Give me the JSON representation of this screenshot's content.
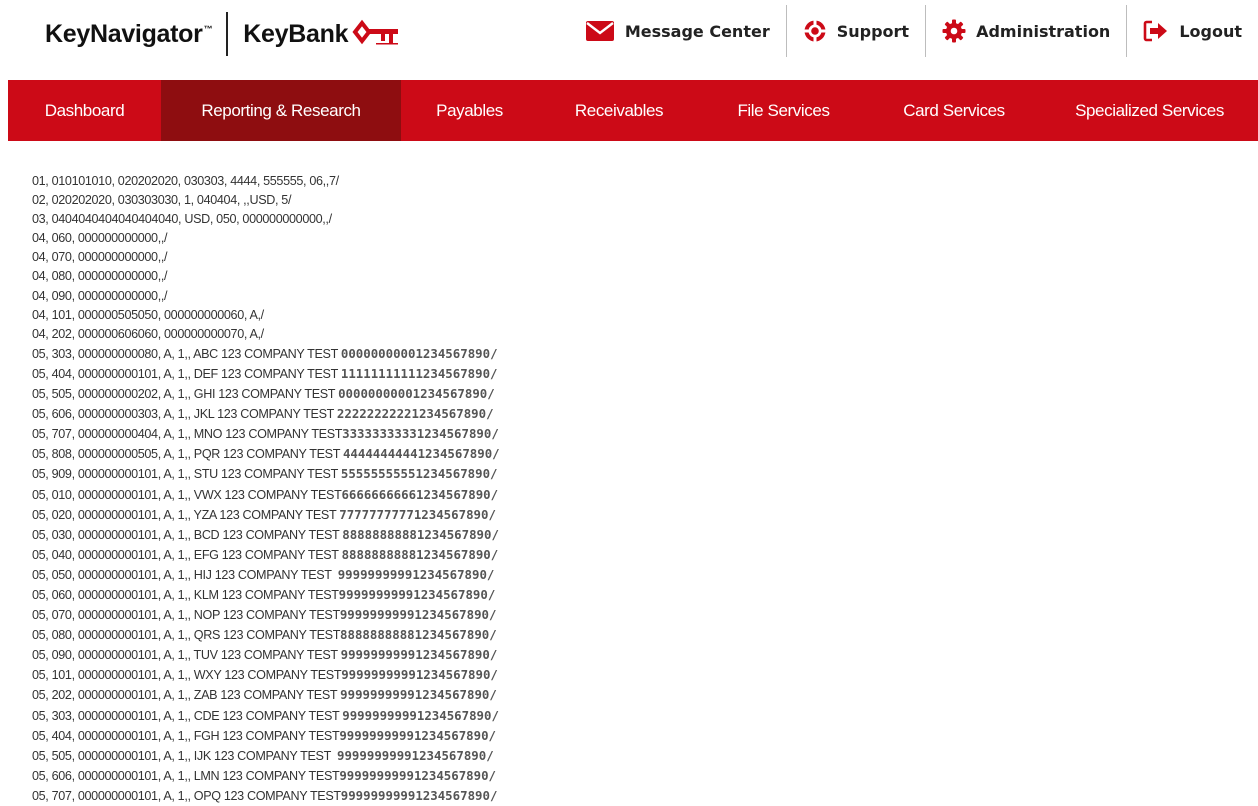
{
  "header": {
    "brand_primary": "KeyNavigator",
    "brand_mark": "™",
    "brand_secondary": "KeyBank",
    "utility_links": [
      {
        "label": "Message Center",
        "icon": "envelope-icon"
      },
      {
        "label": "Support",
        "icon": "lifebuoy-icon"
      },
      {
        "label": "Administration",
        "icon": "gear-icon"
      },
      {
        "label": "Logout",
        "icon": "logout-icon"
      }
    ]
  },
  "colors": {
    "brand_red": "#cc0a17",
    "active_tab_red": "#8e0d10",
    "text_gray": "#333333"
  },
  "nav": {
    "active": "Reporting & Research",
    "tabs": [
      {
        "label": "Dashboard"
      },
      {
        "label": "Reporting & Research"
      },
      {
        "label": "Payables"
      },
      {
        "label": "Receivables"
      },
      {
        "label": "File Services"
      },
      {
        "label": "Card Services"
      },
      {
        "label": "Specialized Services"
      }
    ]
  },
  "bai_file": {
    "header_lines": [
      "01, 010101010, 020202020, 030303, 4444, 555555, 06,,7/",
      "02, 020202020, 030303030, 1, 040404, ,,USD, 5/",
      "03, 0404040404040404040, USD, 050, 000000000000,,/",
      "04, 060, 000000000000,,/",
      "04, 070, 000000000000,,/",
      "04, 080, 000000000000,,/",
      "04, 090, 000000000000,,/",
      "04, 101, 000000505050, 000000000060, A,/",
      "04, 202, 000000606060, 000000000070, A,/"
    ],
    "detail_lines": [
      {
        "text": "05, 303, 000000000080, A, 1,, ABC 123 COMPANY TEST ",
        "ref": "00000000001234567890/"
      },
      {
        "text": "05, 404, 000000000101, A, 1,, DEF 123 COMPANY TEST ",
        "ref": "11111111111234567890/"
      },
      {
        "text": "05, 505, 000000000202, A, 1,, GHI 123 COMPANY TEST ",
        "ref": "00000000001234567890/"
      },
      {
        "text": "05, 606, 000000000303, A, 1,, JKL 123 COMPANY TEST ",
        "ref": "22222222221234567890/"
      },
      {
        "text": "05, 707, 000000000404, A, 1,, MNO 123 COMPANY TEST",
        "ref": "33333333331234567890/"
      },
      {
        "text": "05, 808, 000000000505, A, 1,, PQR 123 COMPANY TEST ",
        "ref": "44444444441234567890/"
      },
      {
        "text": "05, 909, 000000000101, A, 1,, STU 123 COMPANY TEST ",
        "ref": "55555555551234567890/"
      },
      {
        "text": "05, 010, 000000000101, A, 1,, VWX 123 COMPANY TEST",
        "ref": "66666666661234567890/"
      },
      {
        "text": "05, 020, 000000000101, A, 1,, YZA 123 COMPANY TEST ",
        "ref": "77777777771234567890/"
      },
      {
        "text": "05, 030, 000000000101, A, 1,, BCD 123 COMPANY TEST ",
        "ref": "88888888881234567890/"
      },
      {
        "text": "05, 040, 000000000101, A, 1,, EFG 123 COMPANY TEST ",
        "ref": "88888888881234567890/"
      },
      {
        "text": "05, 050, 000000000101, A, 1,, HIJ 123 COMPANY TEST  ",
        "ref": "99999999991234567890/"
      },
      {
        "text": "05, 060, 000000000101, A, 1,, KLM 123 COMPANY TEST",
        "ref": "99999999991234567890/"
      },
      {
        "text": "05, 070, 000000000101, A, 1,, NOP 123 COMPANY TEST",
        "ref": "99999999991234567890/"
      },
      {
        "text": "05, 080, 000000000101, A, 1,, QRS 123 COMPANY TEST",
        "ref": "88888888881234567890/"
      },
      {
        "text": "05, 090, 000000000101, A, 1,, TUV 123 COMPANY TEST ",
        "ref": "99999999991234567890/"
      },
      {
        "text": "05, 101, 000000000101, A, 1,, WXY 123 COMPANY TEST",
        "ref": "99999999991234567890/"
      },
      {
        "text": "05, 202, 000000000101, A, 1,, ZAB 123 COMPANY TEST ",
        "ref": "99999999991234567890/"
      },
      {
        "text": "05, 303, 000000000101, A, 1,, CDE 123 COMPANY TEST ",
        "ref": "99999999991234567890/"
      },
      {
        "text": "05, 404, 000000000101, A, 1,, FGH 123 COMPANY TEST",
        "ref": "99999999991234567890/"
      },
      {
        "text": "05, 505, 000000000101, A, 1,, IJK 123 COMPANY TEST  ",
        "ref": "99999999991234567890/"
      },
      {
        "text": "05, 606, 000000000101, A, 1,, LMN 123 COMPANY TEST",
        "ref": "99999999991234567890/"
      },
      {
        "text": "05, 707, 000000000101, A, 1,, OPQ 123 COMPANY TEST",
        "ref": "99999999991234567890/"
      }
    ]
  }
}
